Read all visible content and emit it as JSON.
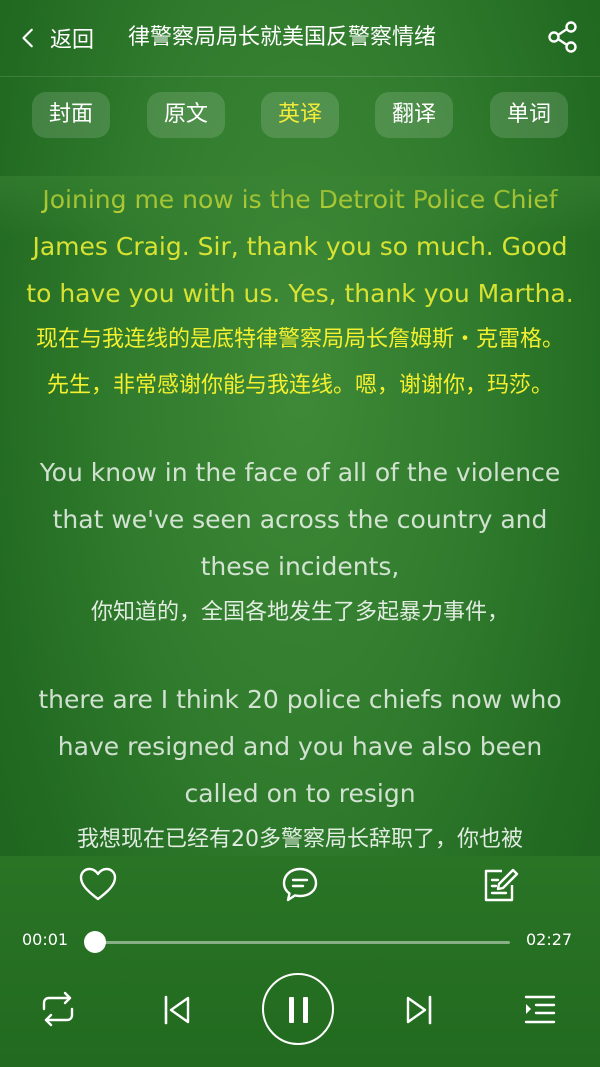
{
  "header": {
    "back_label": "返回",
    "title": "律警察局局长就美国反警察情绪"
  },
  "tabs": [
    {
      "label": "封面",
      "active": false
    },
    {
      "label": "原文",
      "active": false
    },
    {
      "label": "英译",
      "active": true
    },
    {
      "label": "翻译",
      "active": false
    },
    {
      "label": "单词",
      "active": false
    }
  ],
  "transcript": [
    {
      "en": "Joining me now is the Detroit Police Chief James Craig. Sir, thank you so much. Good to have you with us. Yes, thank you Martha.",
      "zh": "现在与我连线的是底特律警察局局长詹姆斯・克雷格。先生，非常感谢你能与我连线。嗯，谢谢你，玛莎。",
      "active": true
    },
    {
      "en": "You know in the face of all of the violence that we've seen across the country and these incidents,",
      "zh": "你知道的，全国各地发生了多起暴力事件，",
      "active": false
    },
    {
      "en": "there are I think 20 police chiefs now who have resigned and you have also been called on to resign",
      "zh": "我想现在已经有20多警察局长辞职了，你也被",
      "active": false
    }
  ],
  "player": {
    "current_time": "00:01",
    "total_time": "02:27",
    "progress": 0.007,
    "state": "playing",
    "icons": {
      "favorite": "heart-icon",
      "comment": "comment-icon",
      "notes": "note-edit-icon",
      "repeat": "repeat-icon",
      "previous": "previous-track-icon",
      "pause": "pause-icon",
      "next": "next-track-icon",
      "playlist": "playlist-icon"
    }
  },
  "colors": {
    "accent": "#f3ea3a",
    "background": "#2f7a2c"
  }
}
